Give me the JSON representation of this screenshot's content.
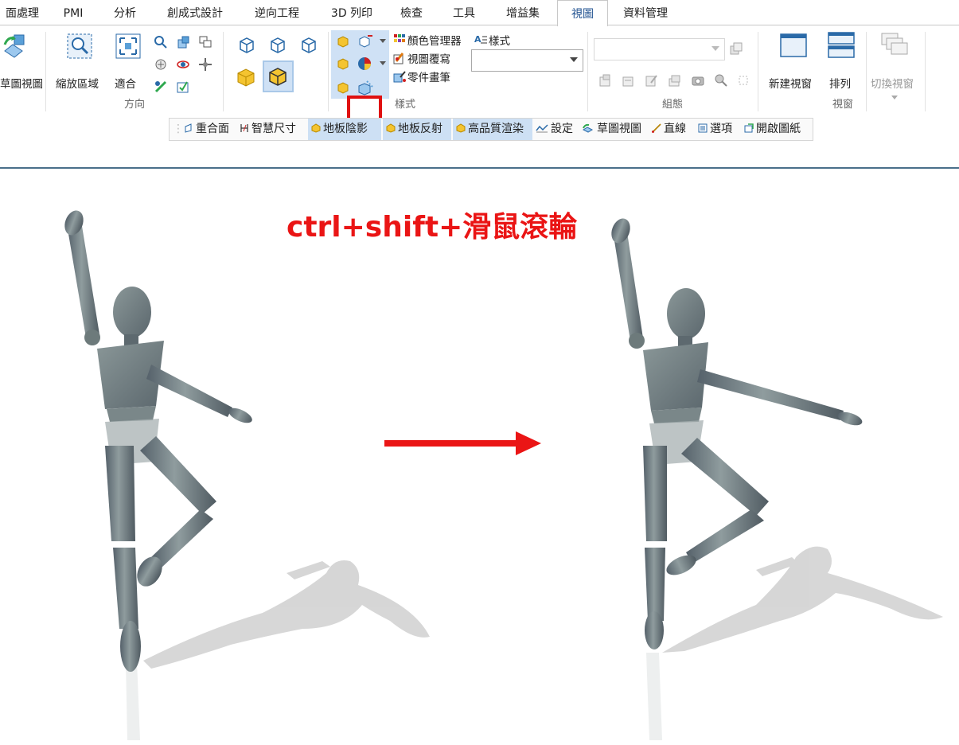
{
  "tabs": [
    {
      "label": "面處理"
    },
    {
      "label": "PMI"
    },
    {
      "label": "分析"
    },
    {
      "label": "創成式設計"
    },
    {
      "label": "逆向工程"
    },
    {
      "label": "3D 列印"
    },
    {
      "label": "檢查"
    },
    {
      "label": "工具"
    },
    {
      "label": "增益集"
    },
    {
      "label": "視圖"
    },
    {
      "label": "資料管理"
    }
  ],
  "active_tab": "視圖",
  "ribbon": {
    "sketch_view_label": "草圖視圖",
    "zoom_area_label": "縮放區域",
    "fit_label": "適合",
    "orient_group": "方向",
    "color_manager": "顏色管理器",
    "view_override": "視圖覆寫",
    "part_painter": "零件畫筆",
    "style_label": "樣式",
    "style_group": "樣式",
    "config_group": "組態",
    "new_window": "新建視窗",
    "arrange": "排列",
    "switch_window": "切換視窗",
    "window_group": "視窗"
  },
  "toolbar2": [
    {
      "label": "重合面"
    },
    {
      "label": "智慧尺寸"
    },
    {
      "label": "地板陰影"
    },
    {
      "label": "地板反射"
    },
    {
      "label": "高品質渲染"
    },
    {
      "label": "設定"
    },
    {
      "label": "草圖視圖"
    },
    {
      "label": "直線"
    },
    {
      "label": "選項"
    },
    {
      "label": "開啟圖紙"
    }
  ],
  "viewport": {
    "caption": "ctrl+shift+滑鼠滾輪"
  },
  "colors": {
    "accent_red": "#ea1515",
    "active_tab_text": "#1d4f8f",
    "highlight": "#cfe1f5",
    "figure": "#6d7a7b"
  }
}
